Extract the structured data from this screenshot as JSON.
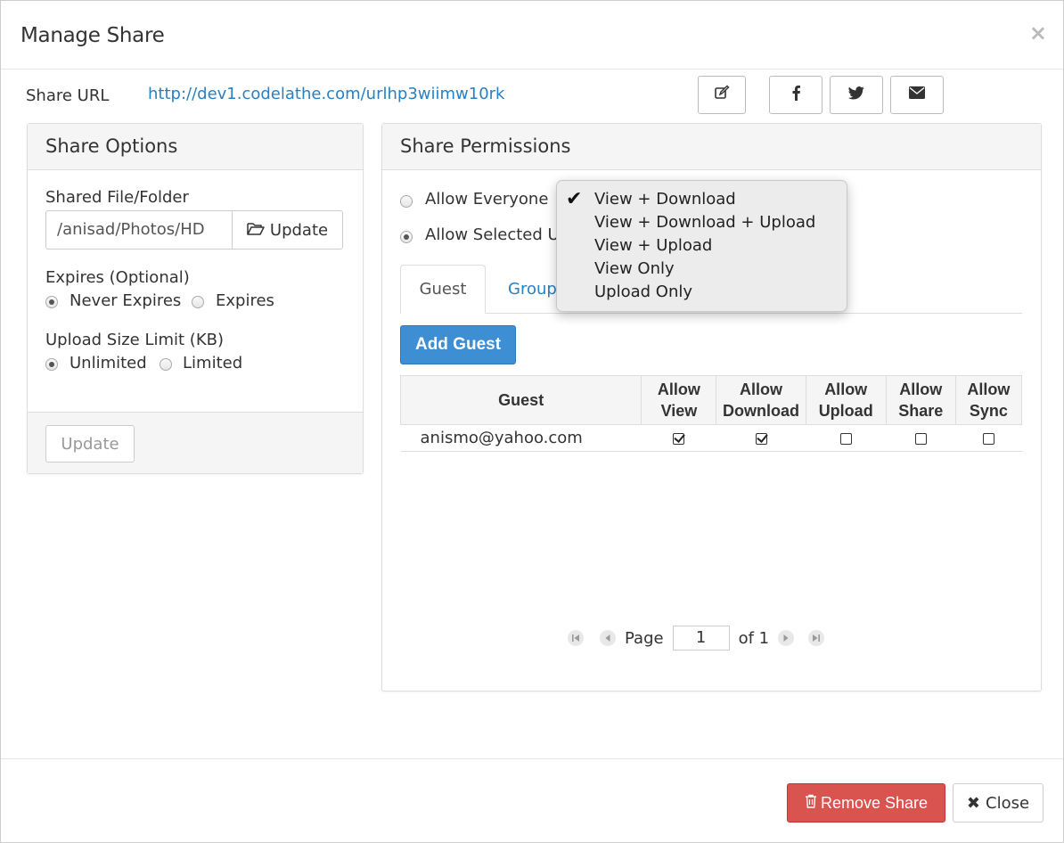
{
  "modal": {
    "title": "Manage Share",
    "close_icon": "×"
  },
  "share_url": {
    "label": "Share URL",
    "url": "http://dev1.codelathe.com/urlhp3wiimw10rk"
  },
  "share_actions": [
    "edit-icon",
    "facebook-icon",
    "twitter-icon",
    "envelope-icon"
  ],
  "share_options": {
    "heading": "Share Options",
    "shared_label": "Shared File/Folder",
    "path_value": "/anisad/Photos/HD",
    "update_path_label": "Update",
    "expires_label": "Expires (Optional)",
    "never_expires": "Never Expires",
    "expires": "Expires",
    "expires_selected": "never",
    "upload_limit_label": "Upload Size Limit (KB)",
    "unlimited": "Unlimited",
    "limited": "Limited",
    "upload_selected": "unlimited",
    "update_button": "Update"
  },
  "permissions": {
    "heading": "Share Permissions",
    "allow_everyone": "Allow Everyone",
    "allow_selected": "Allow Selected U",
    "selected": "allow_selected",
    "tabs": [
      {
        "label": "Guest",
        "active": true
      },
      {
        "label": "Group",
        "active": false
      }
    ],
    "add_guest": "Add Guest",
    "table": {
      "headers": [
        {
          "line1": "Guest",
          "line2": ""
        },
        {
          "line1": "Allow",
          "line2": "View"
        },
        {
          "line1": "Allow",
          "line2": "Download"
        },
        {
          "line1": "Allow",
          "line2": "Upload"
        },
        {
          "line1": "Allow",
          "line2": "Share"
        },
        {
          "line1": "Allow",
          "line2": "Sync"
        }
      ],
      "rows": [
        {
          "email": "anismo@yahoo.com",
          "view": true,
          "download": true,
          "upload": false,
          "share": false,
          "sync": false
        }
      ]
    },
    "pager": {
      "page_label": "Page",
      "page_value": "1",
      "of_label": "of 1"
    }
  },
  "dropdown": {
    "options": [
      {
        "label": "View + Download",
        "checked": true
      },
      {
        "label": "View + Download + Upload",
        "checked": false
      },
      {
        "label": "View + Upload",
        "checked": false
      },
      {
        "label": "View Only",
        "checked": false
      },
      {
        "label": "Upload Only",
        "checked": false
      }
    ]
  },
  "footer": {
    "remove_share": "Remove Share",
    "close": "Close"
  },
  "colors": {
    "link": "#2a7fc0",
    "primary": "#3d8ed3",
    "danger": "#d9534f"
  }
}
